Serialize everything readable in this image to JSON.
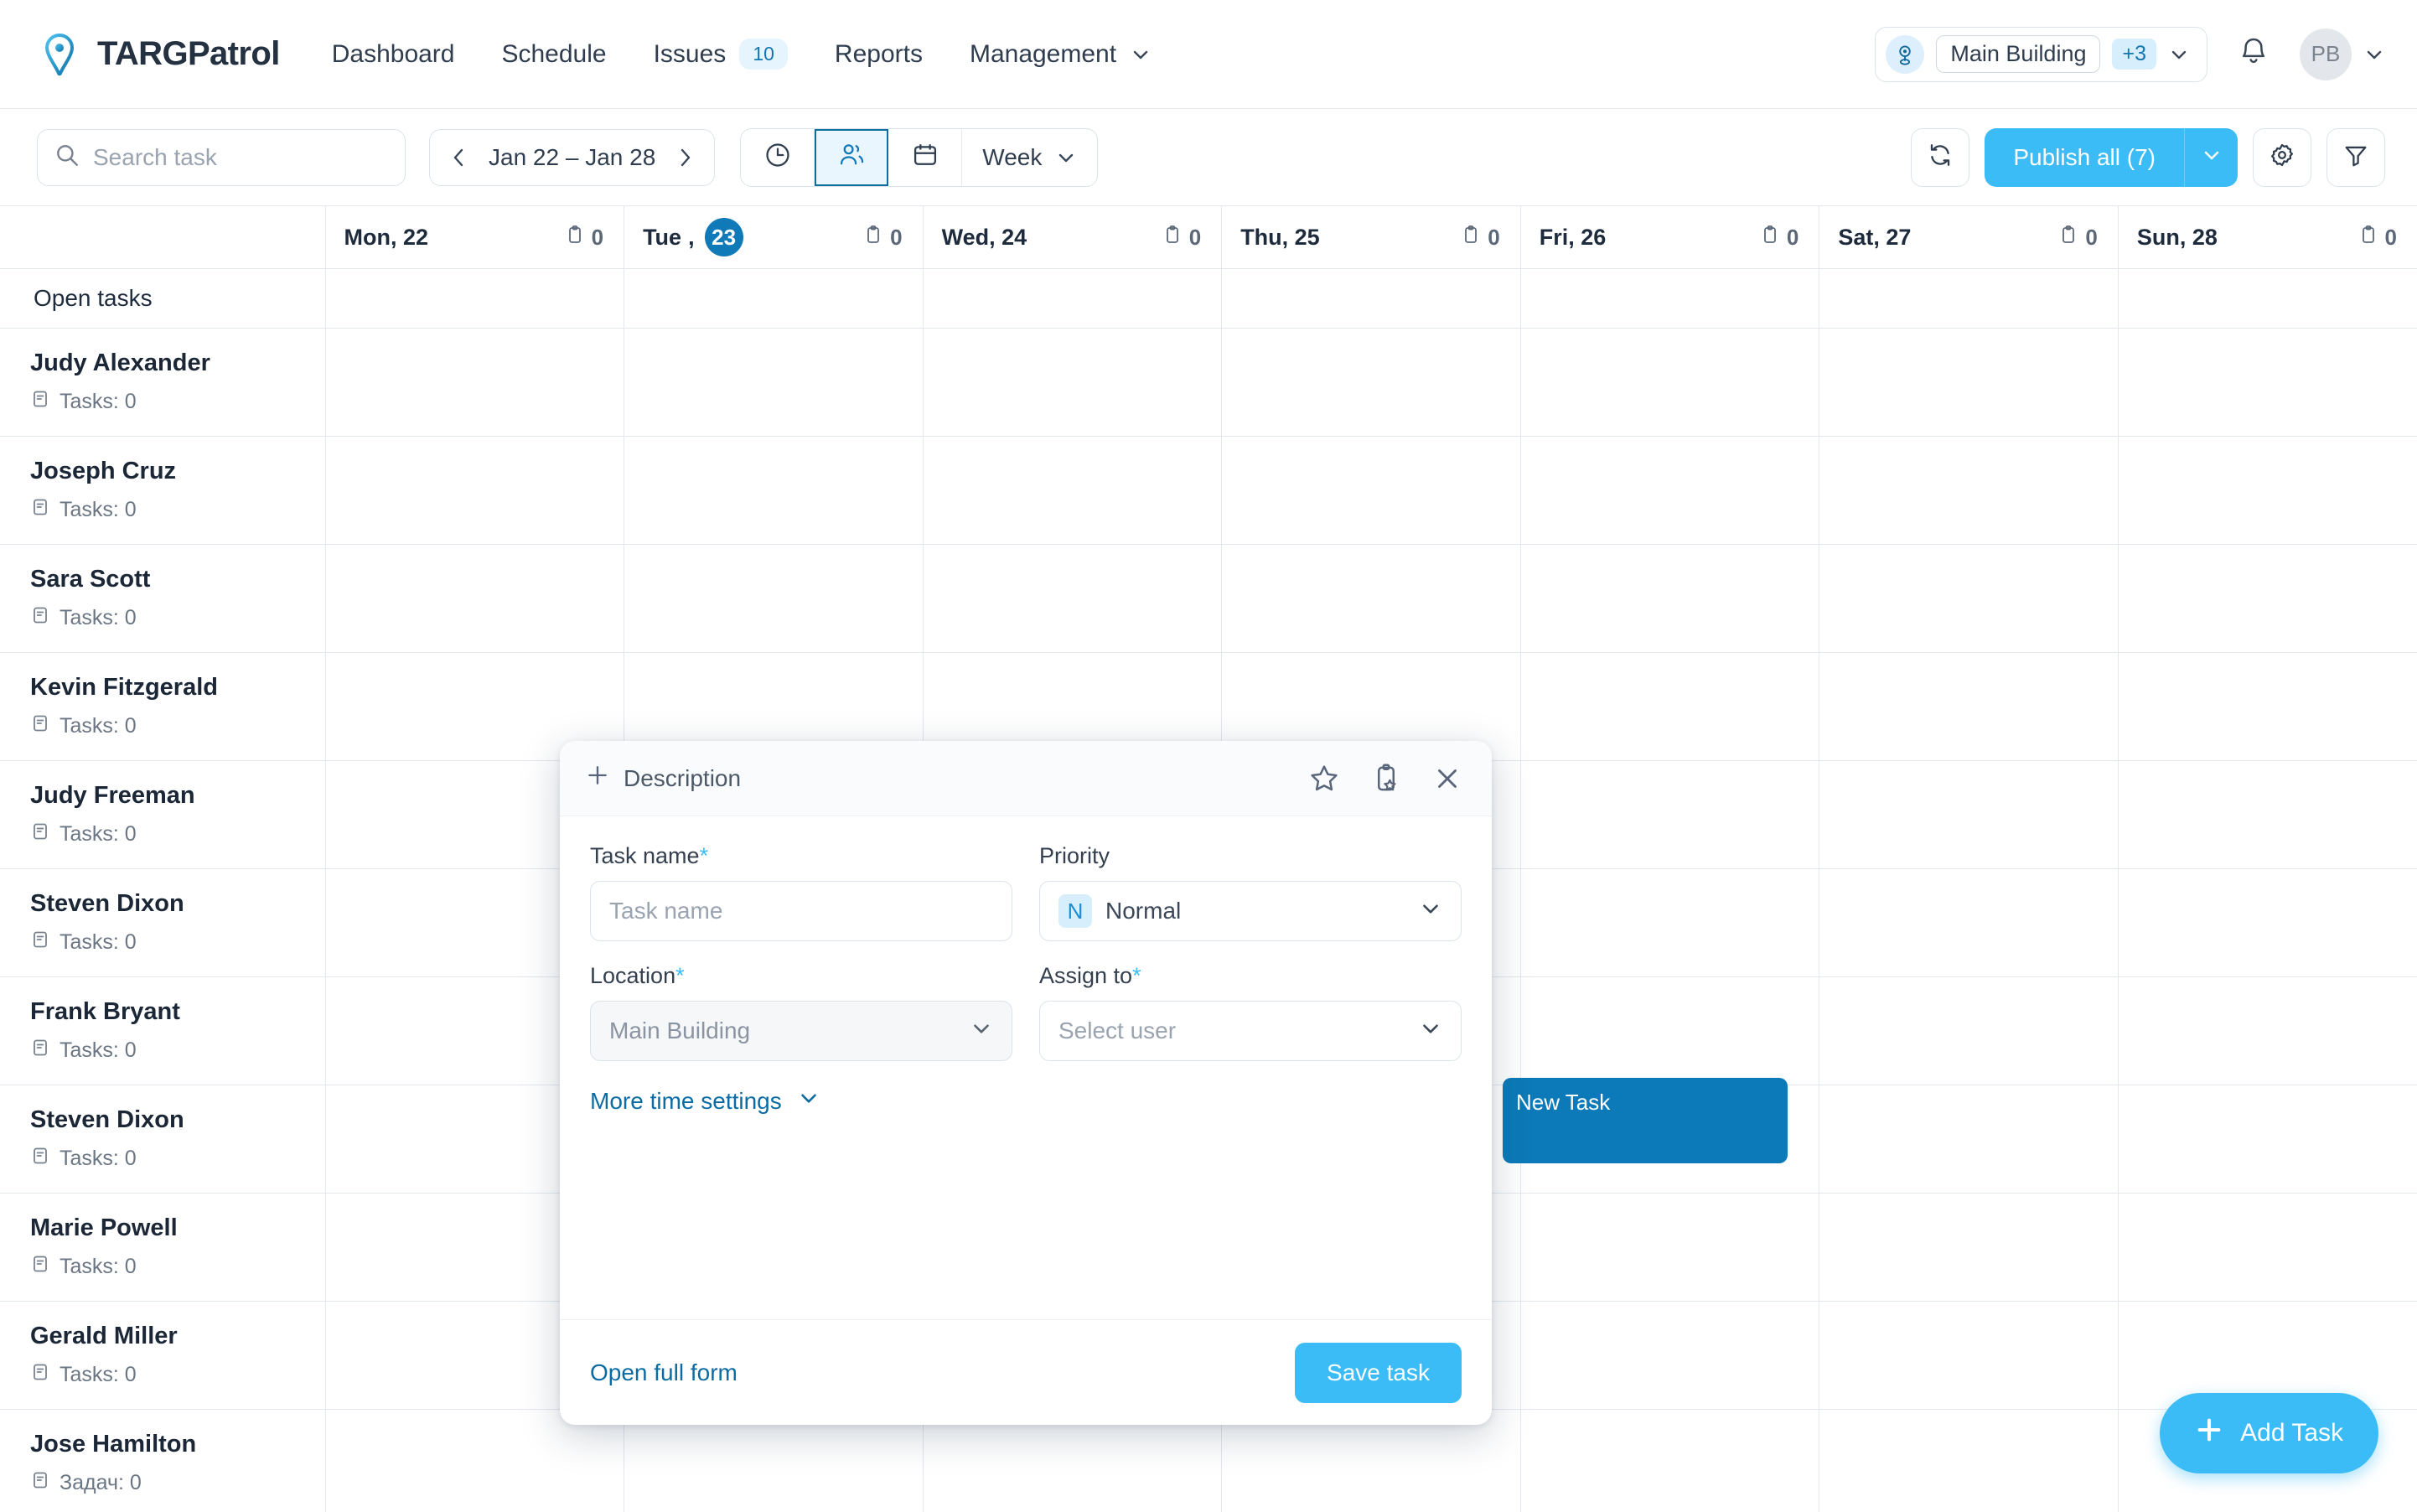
{
  "brand": {
    "name": "TARGPatrol",
    "logo_icon": "location-pin-logo"
  },
  "nav": {
    "items": [
      {
        "label": "Dashboard",
        "badge": null,
        "caret": false
      },
      {
        "label": "Schedule",
        "badge": null,
        "caret": false
      },
      {
        "label": "Issues",
        "badge": "10",
        "caret": false
      },
      {
        "label": "Reports",
        "badge": null,
        "caret": false
      },
      {
        "label": "Management",
        "badge": null,
        "caret": true
      }
    ]
  },
  "header_right": {
    "location_name": "Main Building",
    "location_extra": "+3",
    "notifications_icon": "bell-icon",
    "avatar_initials": "PB"
  },
  "toolbar": {
    "search_placeholder": "Search task",
    "search_value": "",
    "date_range": "Jan 22 – Jan 28",
    "views": [
      {
        "icon": "clock-icon",
        "active": false
      },
      {
        "icon": "people-icon",
        "active": true
      },
      {
        "icon": "calendar-icon",
        "active": false
      }
    ],
    "period_label": "Week",
    "refresh_icon": "refresh-icon",
    "publish_label": "Publish all (7)",
    "settings_icon": "gear-icon",
    "filter_icon": "filter-icon"
  },
  "calendar": {
    "open_tasks_label": "Open tasks",
    "days": [
      {
        "label": "Mon, 22",
        "date_num": "22",
        "weekday": "Mon",
        "count": "0",
        "today": false
      },
      {
        "label": "Tue, 23",
        "date_num": "23",
        "weekday": "Tue",
        "count": "0",
        "today": true
      },
      {
        "label": "Wed, 24",
        "date_num": "24",
        "weekday": "Wed",
        "count": "0",
        "today": false
      },
      {
        "label": "Thu, 25",
        "date_num": "25",
        "weekday": "Thu",
        "count": "0",
        "today": false
      },
      {
        "label": "Fri, 26",
        "date_num": "26",
        "weekday": "Fri",
        "count": "0",
        "today": false
      },
      {
        "label": "Sat, 27",
        "date_num": "27",
        "weekday": "Sat",
        "count": "0",
        "today": false
      },
      {
        "label": "Sun, 28",
        "date_num": "28",
        "weekday": "Sun",
        "count": "0",
        "today": false
      }
    ],
    "people": [
      {
        "name": "Judy Alexander",
        "tasks": "Tasks: 0"
      },
      {
        "name": "Joseph Cruz",
        "tasks": "Tasks: 0"
      },
      {
        "name": "Sara Scott",
        "tasks": "Tasks: 0"
      },
      {
        "name": "Kevin Fitzgerald",
        "tasks": "Tasks: 0"
      },
      {
        "name": "Judy Freeman",
        "tasks": "Tasks: 0"
      },
      {
        "name": "Steven Dixon",
        "tasks": "Tasks: 0"
      },
      {
        "name": "Frank Bryant",
        "tasks": "Tasks: 0"
      },
      {
        "name": "Steven Dixon",
        "tasks": "Tasks: 0"
      },
      {
        "name": "Marie Powell",
        "tasks": "Tasks: 0"
      },
      {
        "name": "Gerald Miller",
        "tasks": "Tasks: 0"
      },
      {
        "name": "Jose Hamilton",
        "tasks": "Задач: 0"
      }
    ],
    "task_block": {
      "title": "New Task",
      "color": "#0c7ab8"
    }
  },
  "modal": {
    "description_label": "Description",
    "icons": {
      "favorite": "star-icon",
      "template": "clipboard-star-icon",
      "close": "close-icon"
    },
    "task_name_label": "Task name",
    "task_name_placeholder": "Task name",
    "task_name_value": "",
    "priority_label": "Priority",
    "priority_tag": "N",
    "priority_value": "Normal",
    "location_label": "Location",
    "location_value": "Main Building",
    "assign_label": "Assign to",
    "assign_placeholder": "Select user",
    "more_time_label": "More time settings",
    "open_full_form_label": "Open full form",
    "save_label": "Save task"
  },
  "fab": {
    "label": "Add Task",
    "icon": "plus-icon"
  },
  "colors": {
    "accent": "#3cbcf7",
    "accent_dark": "#0c7ab8",
    "link": "#0d6ba3",
    "text": "#1e2b3c",
    "border": "#e3e8ee"
  }
}
